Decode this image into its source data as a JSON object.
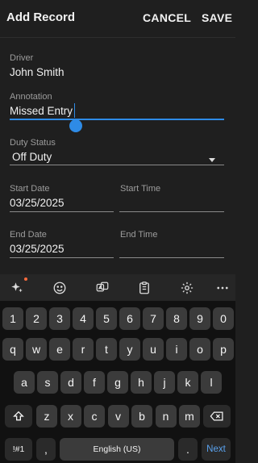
{
  "header": {
    "title": "Add Record",
    "cancel_label": "CANCEL",
    "save_label": "SAVE"
  },
  "form": {
    "driver": {
      "label": "Driver",
      "value": "John Smith"
    },
    "annotation": {
      "label": "Annotation",
      "value": "Missed Entry"
    },
    "duty_status": {
      "label": "Duty Status",
      "value": "Off Duty"
    },
    "start_date": {
      "label": "Start Date",
      "value": "03/25/2025"
    },
    "start_time": {
      "label": "Start Time",
      "value": ""
    },
    "end_date": {
      "label": "End Date",
      "value": "03/25/2025"
    },
    "end_time": {
      "label": "End Time",
      "value": ""
    }
  },
  "keyboard_toolbar": {
    "icons": [
      "ai-sparkle-icon",
      "emoji-icon",
      "text-translate-icon",
      "clipboard-icon",
      "settings-icon",
      "more-icon"
    ],
    "notification_color": "#ff6b3d"
  },
  "keyboard": {
    "number_row": [
      "1",
      "2",
      "3",
      "4",
      "5",
      "6",
      "7",
      "8",
      "9",
      "0"
    ],
    "row1": [
      "q",
      "w",
      "e",
      "r",
      "t",
      "y",
      "u",
      "i",
      "o",
      "p"
    ],
    "row2": [
      "a",
      "s",
      "d",
      "f",
      "g",
      "h",
      "j",
      "k",
      "l"
    ],
    "row3": [
      "z",
      "x",
      "c",
      "v",
      "b",
      "n",
      "m"
    ],
    "symbols_label": "!#1",
    "comma": ",",
    "space_label": "English (US)",
    "period": ".",
    "action_label": "Next"
  },
  "colors": {
    "accent": "#2e8be6",
    "background": "#1f1f1f",
    "key": "#3b3b3b",
    "keyboard_bg": "#111111"
  }
}
